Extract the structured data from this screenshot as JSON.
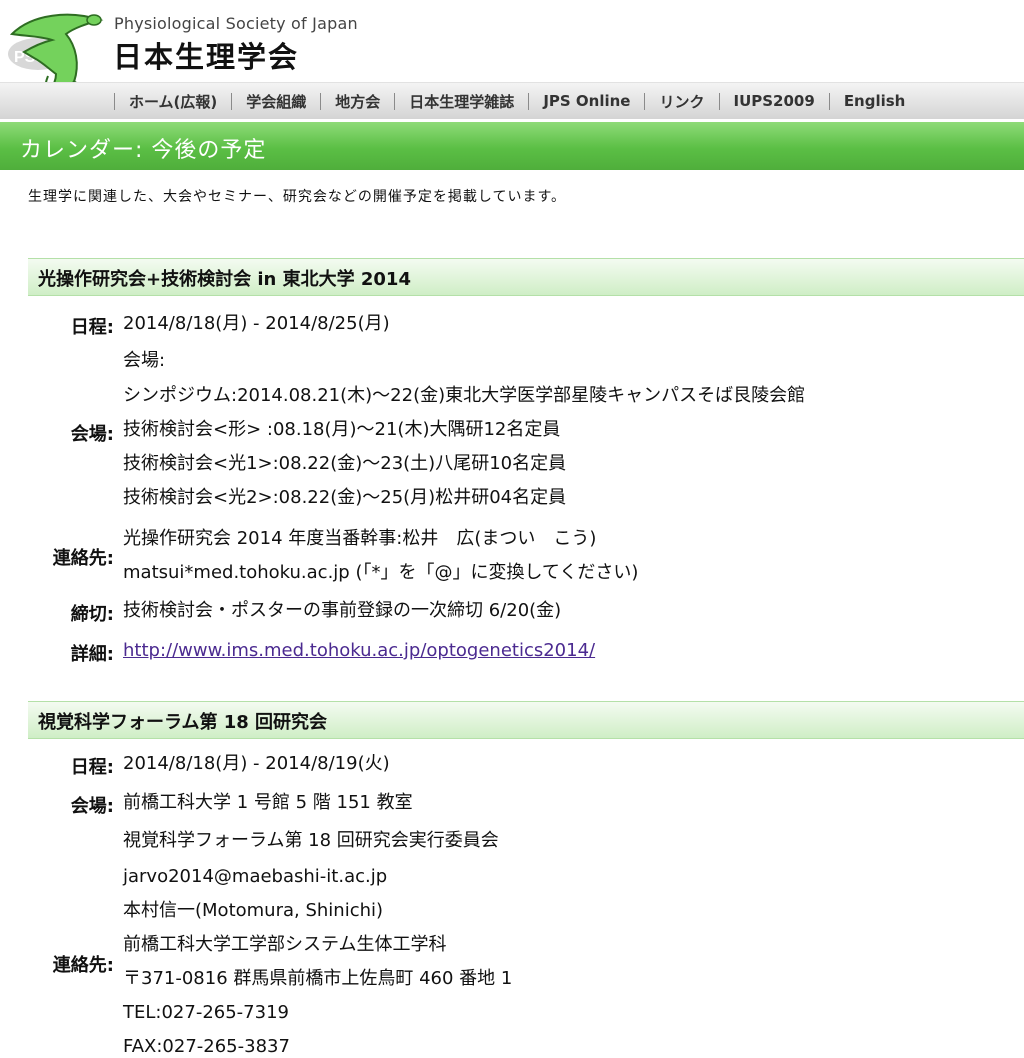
{
  "header": {
    "logo_text": "PSJ",
    "org_name_en": "Physiological Society of Japan",
    "org_name_ja": "日本生理学会"
  },
  "nav": {
    "items": [
      {
        "label": "ホーム(広報)"
      },
      {
        "label": "学会組織"
      },
      {
        "label": "地方会"
      },
      {
        "label": "日本生理学雑誌"
      },
      {
        "label": "JPS Online"
      },
      {
        "label": "リンク"
      },
      {
        "label": "IUPS2009"
      },
      {
        "label": "English"
      }
    ]
  },
  "page": {
    "title": "カレンダー: 今後の予定",
    "intro": "生理学に関連した、大会やセミナー、研究会などの開催予定を掲載しています。"
  },
  "events": [
    {
      "title": "光操作研究会+技術検討会 in 東北大学 2014",
      "schedule_label": "日程:",
      "schedule": "2014/8/18(月) - 2014/8/25(月)",
      "venue_label": "会場:",
      "venue_lines": [
        "会場:",
        "シンポジウム:2014.08.21(木)〜22(金)東北大学医学部星陵キャンパスそば艮陵会館",
        "技術検討会<形> :08.18(月)〜21(木)大隅研12名定員",
        "技術検討会<光1>:08.22(金)〜23(土)八尾研10名定員",
        "技術検討会<光2>:08.22(金)〜25(月)松井研04名定員"
      ],
      "contact_label": "連絡先:",
      "contact_lines": [
        "光操作研究会 2014 年度当番幹事:松井　広(まつい　こう)",
        "matsui*med.tohoku.ac.jp (「*」を「@」に変換してください)"
      ],
      "deadline_label": "締切:",
      "deadline": "技術検討会・ポスターの事前登録の一次締切 6/20(金)",
      "details_label": "詳細:",
      "details_url": "http://www.ims.med.tohoku.ac.jp/optogenetics2014/"
    },
    {
      "title": "視覚科学フォーラム第 18 回研究会",
      "schedule_label": "日程:",
      "schedule": "2014/8/18(月) - 2014/8/19(火)",
      "venue_label": "会場:",
      "venue": "前橋工科大学 1 号館 5 階 151 教室",
      "contact_label": "連絡先:",
      "contact_lines": [
        "視覚科学フォーラム第 18 回研究会実行委員会",
        "jarvo2014@maebashi-it.ac.jp",
        "本村信一(Motomura, Shinichi)",
        "前橋工科大学工学部システム生体工学科",
        "〒371-0816 群馬県前橋市上佐鳥町 460 番地 1",
        "TEL:027-265-7319",
        "FAX:027-265-3837"
      ]
    }
  ]
}
